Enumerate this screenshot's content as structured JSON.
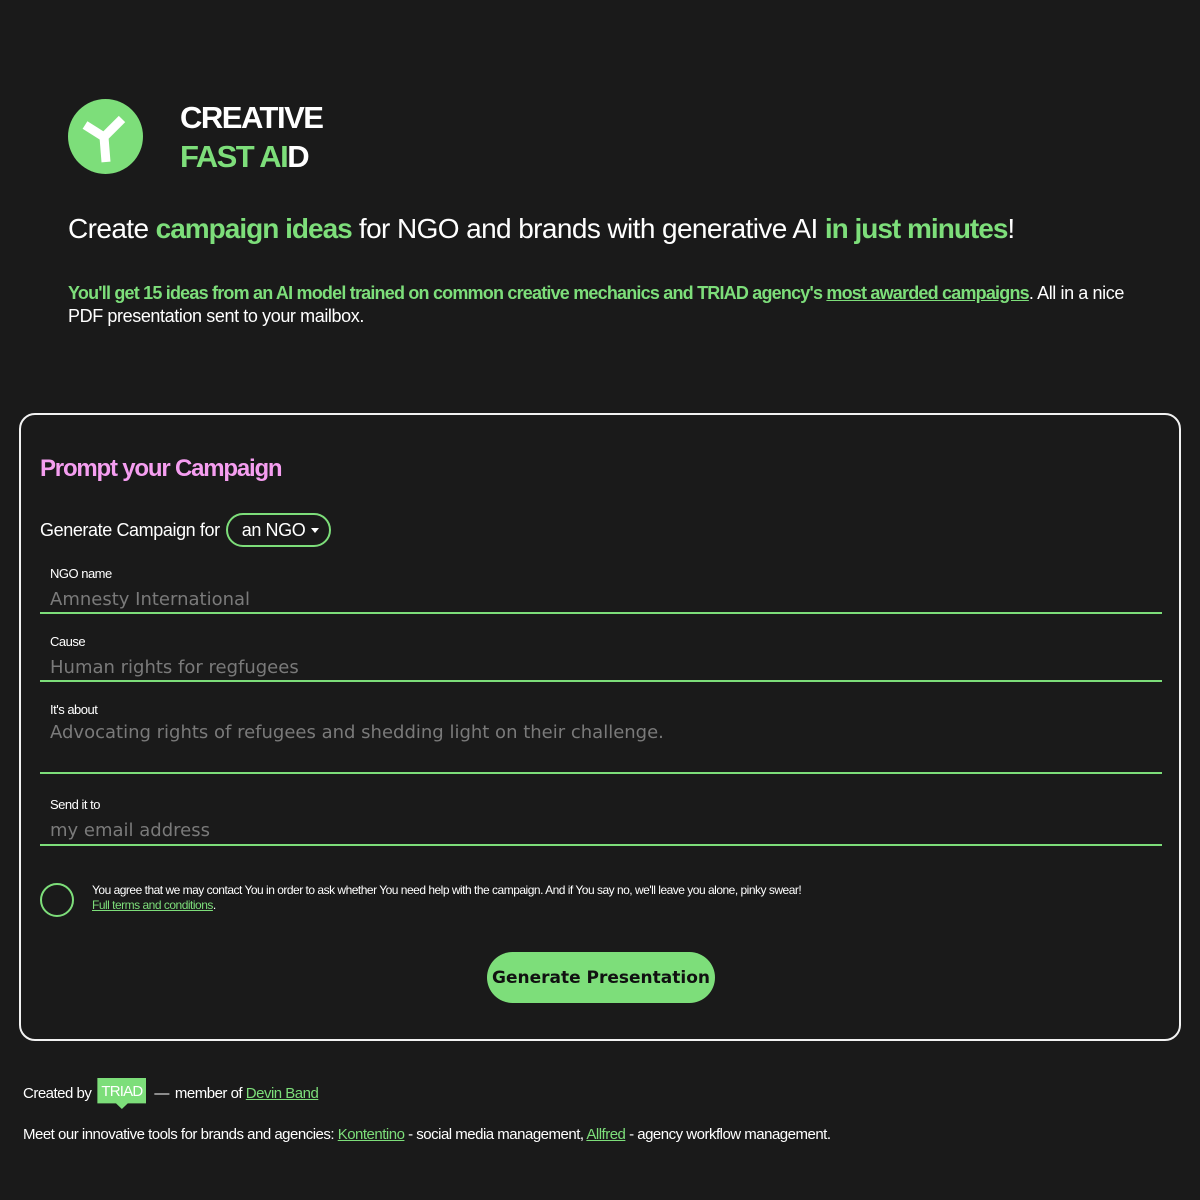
{
  "brand": {
    "line1": "CREATIVE",
    "line2_green": "FAST AI",
    "line2_white": "D",
    "accent": "#7dde7a",
    "logo_icon": "triad-y-icon"
  },
  "headline": {
    "p1": "Create ",
    "h1": "campaign ideas",
    "p2": " for NGO and brands with generative AI ",
    "h2": "in just minutes",
    "p3": "!"
  },
  "intro": {
    "highlight": "You'll get 15 ideas from an AI model trained on common creative mechanics and TRIAD agency's ",
    "link": "most awarded campaigns",
    "rest": ". All in a nice PDF presentation sent to your mailbox."
  },
  "form": {
    "title": "Prompt your Campaign",
    "title_color": "#f59ef0",
    "generate_for_label": "Generate Campaign for",
    "generate_for_value": "an NGO",
    "fields": {
      "ngo_name": {
        "label": "NGO name",
        "placeholder": "Amnesty International"
      },
      "cause": {
        "label": "Cause",
        "placeholder": "Human rights for regfugees"
      },
      "about": {
        "label": "It's about",
        "placeholder": "Advocating rights of refugees and shedding light on their challenge."
      },
      "email": {
        "label": "Send it to",
        "placeholder": "my email address"
      }
    },
    "consent": {
      "text": "You agree that we may contact You in order to ask whether You need help with the campaign. And if You say no, we'll leave you alone, pinky swear!",
      "link": "Full terms and conditions",
      "link_suffix": "."
    },
    "submit_label": "Generate Presentation"
  },
  "footer": {
    "created_by": "Created by",
    "badge": "TRIAD",
    "dash": "—",
    "member_of": "member of",
    "member_link": "Devin Band",
    "tools_intro": "Meet our innovative tools for brands and agencies: ",
    "tool1": "Kontentino",
    "tool1_desc": " - social media management, ",
    "tool2": "Allfred",
    "tool2_desc": " - agency workflow management."
  }
}
